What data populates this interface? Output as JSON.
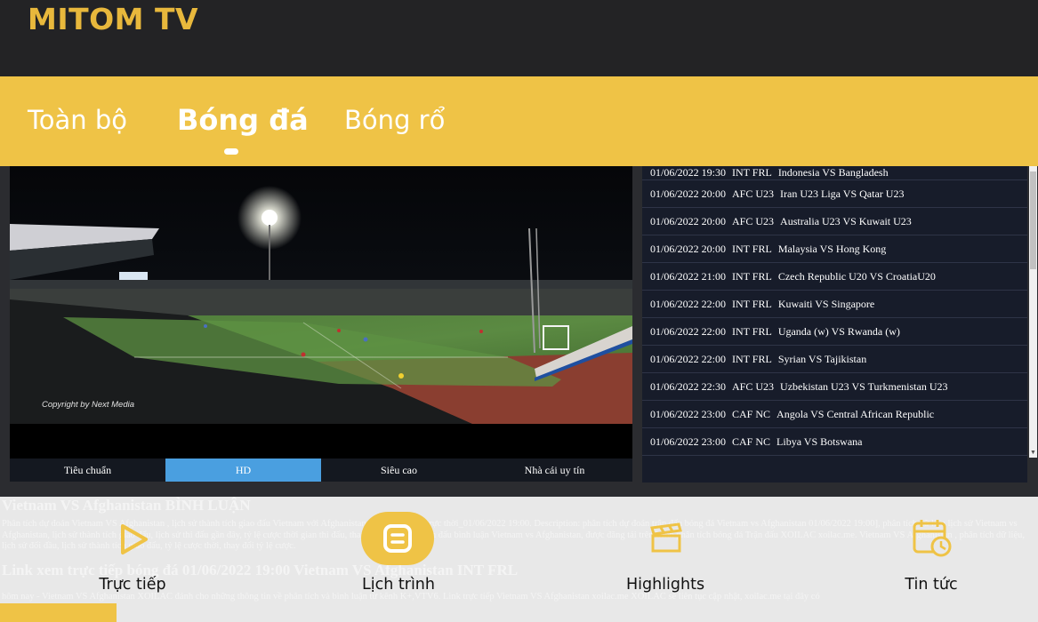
{
  "app": {
    "title": "MITOM TV"
  },
  "tabs": [
    {
      "label": "Toàn bộ",
      "active": false
    },
    {
      "label": "Bóng đá",
      "active": true
    },
    {
      "label": "Bóng rổ",
      "active": false
    }
  ],
  "player": {
    "copyright": "Copyright by Next Media",
    "quality_options": [
      "Tiêu chuẩn",
      "HD",
      "Siêu cao",
      "Nhà cái uy tín"
    ],
    "selected_quality": "HD"
  },
  "schedule": [
    {
      "time": "01/06/2022 19:30",
      "league": "INT FRL",
      "match": "Indonesia VS Bangladesh"
    },
    {
      "time": "01/06/2022 20:00",
      "league": "AFC U23",
      "match": "Iran U23 Liga VS Qatar U23"
    },
    {
      "time": "01/06/2022 20:00",
      "league": "AFC U23",
      "match": "Australia U23 VS Kuwait U23"
    },
    {
      "time": "01/06/2022 20:00",
      "league": "INT FRL",
      "match": "Malaysia VS Hong Kong"
    },
    {
      "time": "01/06/2022 21:00",
      "league": "INT FRL",
      "match": "Czech Republic U20 VS CroatiaU20"
    },
    {
      "time": "01/06/2022 22:00",
      "league": "INT FRL",
      "match": "Kuwaiti VS Singapore"
    },
    {
      "time": "01/06/2022 22:00",
      "league": "INT FRL",
      "match": "Uganda (w) VS Rwanda (w)"
    },
    {
      "time": "01/06/2022 22:00",
      "league": "INT FRL",
      "match": "Syrian VS Tajikistan"
    },
    {
      "time": "01/06/2022 22:30",
      "league": "AFC U23",
      "match": "Uzbekistan U23 VS Turkmenistan U23"
    },
    {
      "time": "01/06/2022 23:00",
      "league": "CAF NC",
      "match": "Angola VS Central African Republic"
    },
    {
      "time": "01/06/2022 23:00",
      "league": "CAF NC",
      "match": "Libya VS Botswana"
    }
  ],
  "article": {
    "heading": "Vietnam VS Afghanistan BÌNH LUẬN",
    "paragraph1": "Phân tích dự đoán Vietnam VS Afghanistan , lịch sử thành tích giao đấu Vietnam với Afghanistan, tiêu tỷ lệ cược trực thời_01/06/2022 19:00. Description: phân tích dự đoán trận đấu bóng đá Vietnam vs Afghanistan 01/06/2022 19:00], phân tích dữ liệu lịch sử Vietnam vs Afghanistan, lịch sử thành tích giao đấu, lịch sử thi đấu gần đây, tỷ lệ cược thời gian thi đấu, thay đổi tỷ lệ cược trận đấu bình luận Vietnam vs Afghanistan, được đăng tải trên kênh phân tích bóng đá Trận đấu XOILAC xoilac.me. Vietnam VS Afghanistan , phân tích dữ liệu, lịch sử đối đầu, lịch sử thành tích giao đấu, tỷ lệ cược thời, thay đổi tỷ lệ cược.",
    "subheading": "Link xem trực tiếp bóng đá 01/06/2022 19:00 Vietnam VS Afghanistan INT FRL",
    "paragraph2": "hôm nay - Vietnam VS Afghanistan XOILAC đánh cho những thông tin về phân tích và bình luận từ kênh K+,VTV6. Link trực tiếp Vietnam VS Afghanistan xoilac.me XOILAC sẽ liên tục cập nhật, xoilac.me tại đây có"
  },
  "bottom_nav": [
    {
      "label": "Trực tiếp",
      "icon": "play-icon"
    },
    {
      "label": "Lịch trình",
      "icon": "schedule-icon"
    },
    {
      "label": "Highlights",
      "icon": "clapperboard-icon"
    },
    {
      "label": "Tin tức",
      "icon": "calendar-news-icon"
    }
  ],
  "colors": {
    "accent": "#efc346",
    "brand_text": "#e8b83c",
    "top_bar": "#232325",
    "schedule_bg": "#171c2a",
    "quality_active": "#4a9fe0"
  }
}
